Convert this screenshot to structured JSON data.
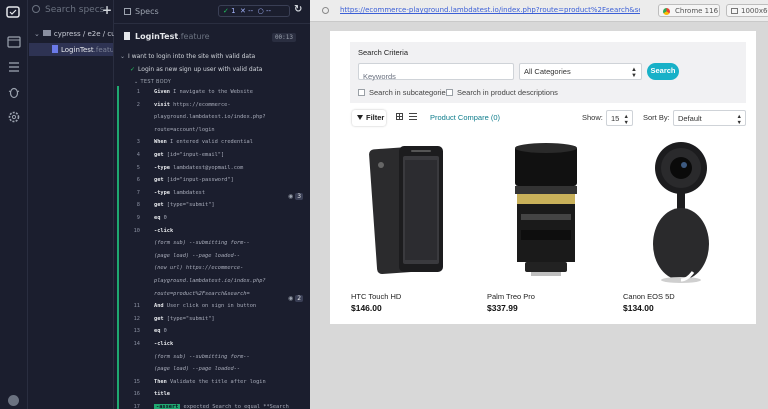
{
  "specs_panel": {
    "search_placeholder": "Search specs",
    "add_label": "+",
    "folder_label": "cypress / e2e / cuc",
    "spec_name": "LoginTest",
    "spec_ext": ".feature"
  },
  "reporter": {
    "header_label": "Specs",
    "stats": {
      "passed_icon": "✓",
      "passed": "1",
      "failed_icon": "✕",
      "failed": "--",
      "pending_icon": "○",
      "pending": "--"
    },
    "reload_icon": "↻",
    "file_name": "LoginTest",
    "file_ext": ".feature",
    "duration": "00:13",
    "suite": "I want to login into the site with valid data",
    "test": "Login as new sign up user with valid data",
    "test_body_label": "TEST BODY",
    "commands": [
      {
        "n": "1",
        "kw": "Given",
        "arg": "I navigate to the Website"
      },
      {
        "n": "2",
        "kw": "visit",
        "arg": "https://ecommerce-"
      },
      {
        "n": "",
        "kw": "",
        "arg": "playground.lambdatest.io/index.php?"
      },
      {
        "n": "",
        "kw": "",
        "arg": "route=account/login"
      },
      {
        "n": "3",
        "kw": "When",
        "arg": "I entered valid credential"
      },
      {
        "n": "4",
        "kw": "get",
        "arg": "[id=\"input-email\"]"
      },
      {
        "n": "5",
        "kw": "-type",
        "arg": "lambdatest@yopmail.com"
      },
      {
        "n": "6",
        "kw": "get",
        "arg": "[id=\"input-password\"]"
      },
      {
        "n": "7",
        "kw": "-type",
        "arg": "lambdatest"
      },
      {
        "n": "8",
        "kw": "get",
        "arg": "[type=\"submit\"]"
      },
      {
        "n": "9",
        "kw": "eq",
        "arg": "0"
      },
      {
        "n": "10",
        "kw": "-click",
        "arg": ""
      },
      {
        "n": "",
        "kw": "",
        "arg": "(form sub)  --submitting form--",
        "italic": true
      },
      {
        "n": "",
        "kw": "",
        "arg": "(page load)  --page loaded--",
        "italic": true
      },
      {
        "n": "",
        "kw": "",
        "arg": "(new url)  https://ecommerce-",
        "italic": true
      },
      {
        "n": "",
        "kw": "",
        "arg": "playground.lambdatest.io/index.php?",
        "italic": true
      },
      {
        "n": "",
        "kw": "",
        "arg": "route=product%2Fsearch&search=",
        "italic": true
      },
      {
        "n": "11",
        "kw": "And",
        "arg": "User click on sign in button"
      },
      {
        "n": "12",
        "kw": "get",
        "arg": "[type=\"submit\"]"
      },
      {
        "n": "13",
        "kw": "eq",
        "arg": "0"
      },
      {
        "n": "14",
        "kw": "-click",
        "arg": ""
      },
      {
        "n": "",
        "kw": "",
        "arg": "(form sub)  --submitting form--",
        "italic": true
      },
      {
        "n": "",
        "kw": "",
        "arg": "(page load)  --page loaded--",
        "italic": true
      },
      {
        "n": "15",
        "kw": "Then",
        "arg": "Validate the title after login"
      },
      {
        "n": "16",
        "kw": "title",
        "arg": ""
      },
      {
        "n": "17",
        "kw": "-assert",
        "arg": "expected  Search  to equal  **Search",
        "assert": true
      },
      {
        "n": "",
        "kw": "",
        "arg": "**"
      }
    ],
    "eye_badges": [
      {
        "count": "3"
      },
      {
        "count": "2"
      }
    ]
  },
  "aut": {
    "url": "https://ecommerce-playground.lambdatest.io/index.php?route=product%2Fsearch&search=",
    "browser": "Chrome 116",
    "viewport": "1000x660",
    "search_criteria_title": "Search Criteria",
    "keywords_placeholder": "Keywords",
    "category_selected": "All Categories",
    "search_button": "Search",
    "check_subcategories": "Search in subcategories",
    "check_descriptions": "Search in product descriptions",
    "filter_label": "Filter",
    "product_compare": "Product Compare (0)",
    "show_label": "Show:",
    "show_value": "15",
    "sort_label": "Sort By:",
    "sort_value": "Default",
    "products": [
      {
        "name": "HTC Touch HD",
        "price": "$146.00"
      },
      {
        "name": "Palm Treo Pro",
        "price": "$337.99"
      },
      {
        "name": "Canon EOS 5D",
        "price": "$134.00"
      }
    ]
  }
}
